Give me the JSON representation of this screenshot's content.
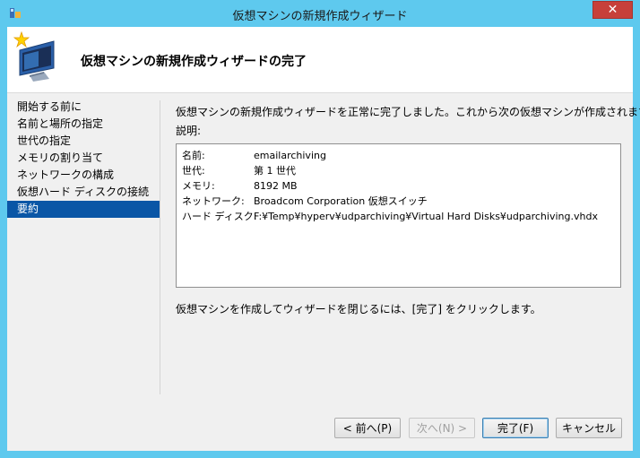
{
  "window": {
    "title": "仮想マシンの新規作成ウィザード",
    "close_label": "✕"
  },
  "header": {
    "title": "仮想マシンの新規作成ウィザードの完了"
  },
  "nav": {
    "items": [
      {
        "label": "開始する前に"
      },
      {
        "label": "名前と場所の指定"
      },
      {
        "label": "世代の指定"
      },
      {
        "label": "メモリの割り当て"
      },
      {
        "label": "ネットワークの構成"
      },
      {
        "label": "仮想ハード ディスクの接続"
      },
      {
        "label": "要約",
        "selected": true
      }
    ]
  },
  "content": {
    "intro": "仮想マシンの新規作成ウィザードを正常に完了しました。これから次の仮想マシンが作成されます。",
    "description_label": "説明:",
    "summary": [
      {
        "key": "名前:",
        "value": "emailarchiving"
      },
      {
        "key": "世代:",
        "value": "第 1 世代"
      },
      {
        "key": "メモリ:",
        "value": "8192 MB"
      },
      {
        "key": "ネットワーク:",
        "value": "Broadcom Corporation 仮想スイッチ"
      },
      {
        "key": "ハード ディスク:",
        "value": "F:¥Temp¥hyperv¥udparchiving¥Virtual Hard Disks¥udparchiving.vhdx"
      }
    ],
    "footer_note": "仮想マシンを作成してウィザードを閉じるには、[完了] をクリックします。"
  },
  "buttons": {
    "previous": "< 前へ(P)",
    "next": "次へ(N) >",
    "finish": "完了(F)",
    "cancel": "キャンセル"
  },
  "colors": {
    "title_bar": "#5ec9ee",
    "close_button": "#c7403a",
    "selected_nav": "#0a56a6",
    "client_bg": "#f0f0f0"
  }
}
